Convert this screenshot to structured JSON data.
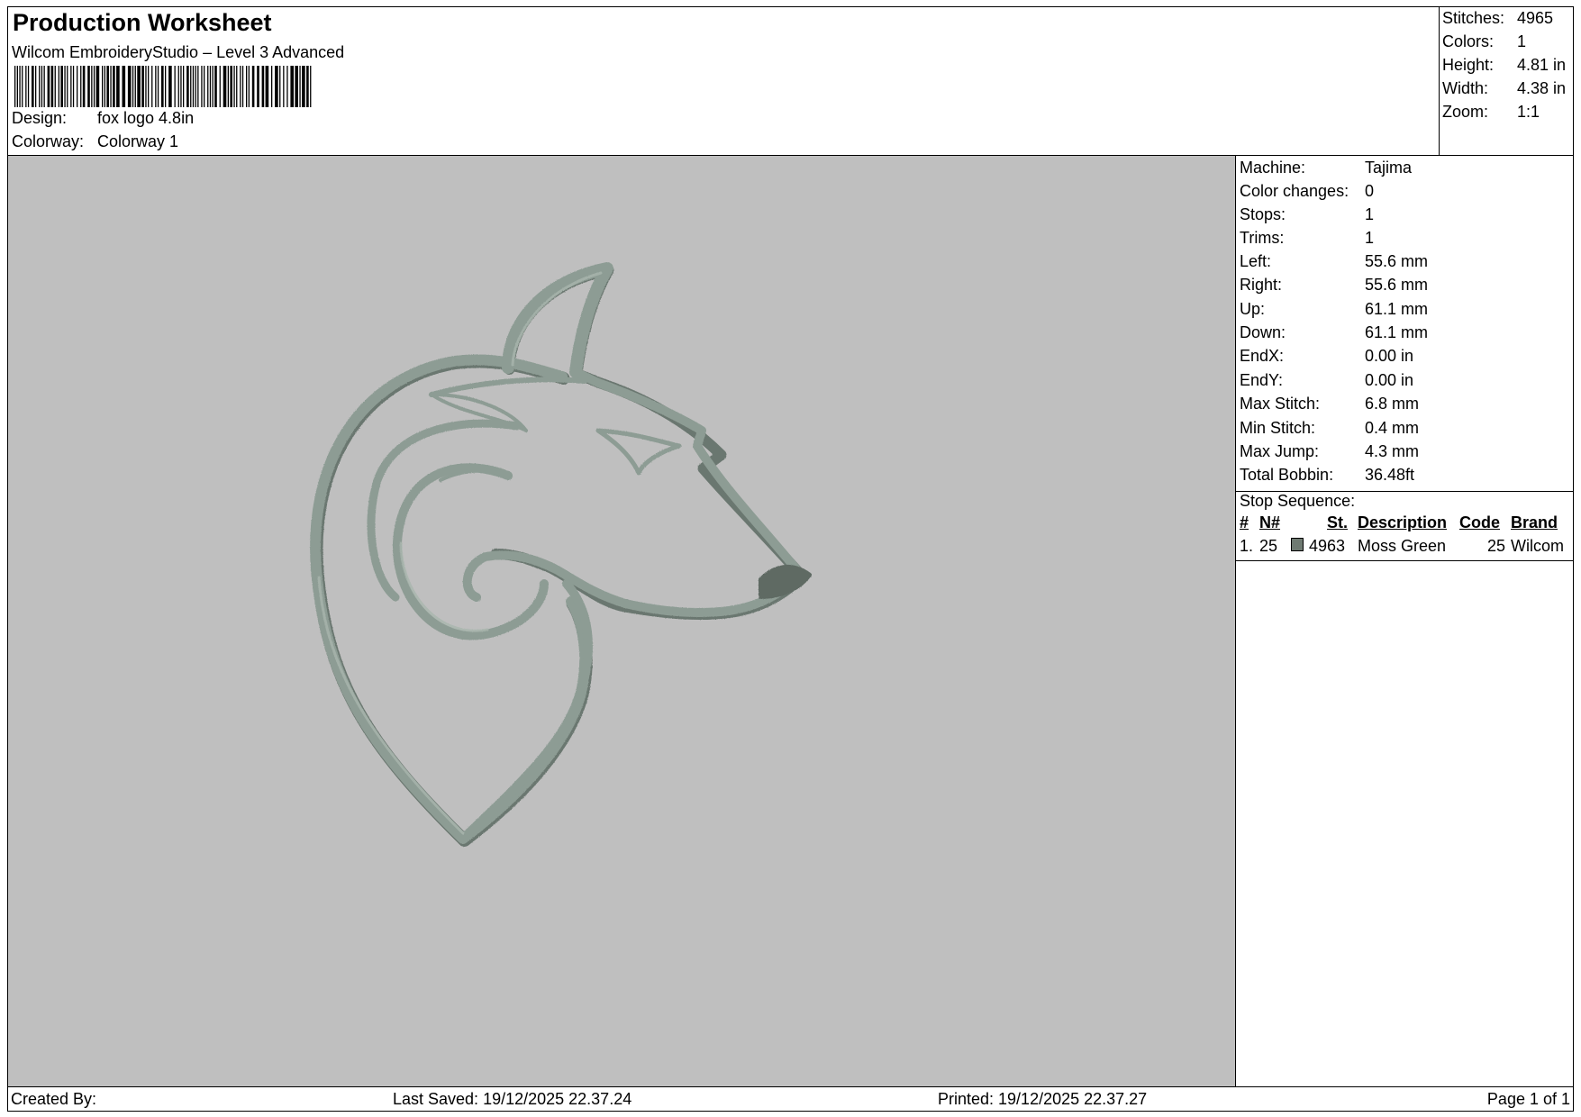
{
  "header": {
    "title": "Production Worksheet",
    "subtitle": "Wilcom EmbroideryStudio – Level 3 Advanced",
    "design_label": "Design:",
    "design_value": "fox logo 4.8in",
    "colorway_label": "Colorway:",
    "colorway_value": "Colorway 1"
  },
  "stats": [
    {
      "label": "Stitches:",
      "value": "4965"
    },
    {
      "label": "Colors:",
      "value": "1"
    },
    {
      "label": "Height:",
      "value": "4.81 in"
    },
    {
      "label": "Width:",
      "value": "4.38 in"
    },
    {
      "label": "Zoom:",
      "value": "1:1"
    }
  ],
  "machine": [
    {
      "label": "Machine:",
      "value": "Tajima"
    },
    {
      "label": "Color changes:",
      "value": "0"
    },
    {
      "label": "Stops:",
      "value": "1"
    },
    {
      "label": "Trims:",
      "value": "1"
    },
    {
      "label": "Left:",
      "value": "55.6 mm"
    },
    {
      "label": "Right:",
      "value": "55.6 mm"
    },
    {
      "label": "Up:",
      "value": "61.1 mm"
    },
    {
      "label": "Down:",
      "value": "61.1 mm"
    },
    {
      "label": "EndX:",
      "value": "0.00 in"
    },
    {
      "label": "EndY:",
      "value": "0.00 in"
    },
    {
      "label": "Max Stitch:",
      "value": "6.8 mm"
    },
    {
      "label": "Min Stitch:",
      "value": "0.4 mm"
    },
    {
      "label": "Max Jump:",
      "value": "4.3 mm"
    },
    {
      "label": "Total Bobbin:",
      "value": "36.48ft"
    }
  ],
  "stop_sequence": {
    "title": "Stop Sequence:",
    "headers": {
      "num": "#",
      "needle": "N#",
      "stitches": "St.",
      "description": "Description",
      "code": "Code",
      "brand": "Brand"
    },
    "rows": [
      {
        "num": "1.",
        "needle": "25",
        "stitches": "4963",
        "description": "Moss Green",
        "code": "25",
        "brand": "Wilcom",
        "color": "#6f7a72"
      }
    ]
  },
  "canvas": {
    "background": "#bfbfbf",
    "thread_color": "#7f8f88",
    "motif": "fox-head-logo"
  },
  "footer": {
    "created_by": "Created By:",
    "last_saved": "Last Saved: 19/12/2025 22.37.24",
    "printed": "Printed: 19/12/2025 22.37.27",
    "page": "Page 1 of 1"
  }
}
